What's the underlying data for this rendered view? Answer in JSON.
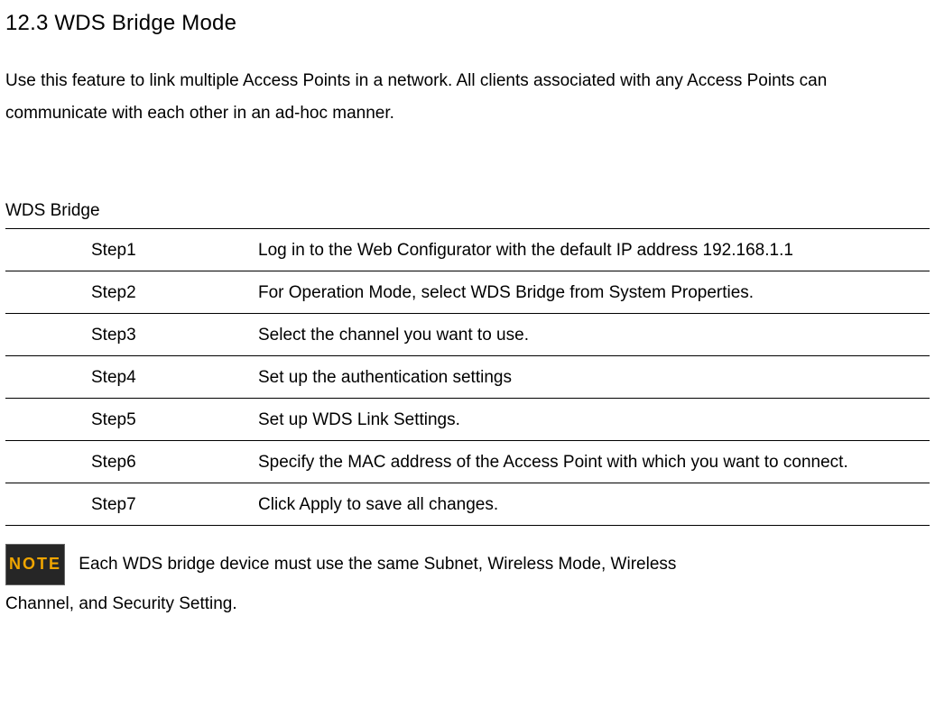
{
  "heading": "12.3 WDS Bridge Mode",
  "intro": "Use this feature to link multiple Access Points in a network. All clients associated with any Access Points can communicate with each other in an ad-hoc manner.",
  "table": {
    "title": "WDS Bridge",
    "steps": [
      {
        "label": "Step1",
        "desc": "Log in to the Web Configurator with the default IP address 192.168.1.1"
      },
      {
        "label": "Step2",
        "desc": "For Operation Mode, select WDS Bridge from System Properties."
      },
      {
        "label": "Step3",
        "desc": "Select the channel you want to use."
      },
      {
        "label": "Step4",
        "desc": "Set up the authentication settings"
      },
      {
        "label": "Step5",
        "desc": "Set up WDS Link Settings."
      },
      {
        "label": "Step6",
        "desc": "Specify the MAC address of the Access Point with which you want to connect."
      },
      {
        "label": "Step7",
        "desc": "Click Apply to save all changes."
      }
    ]
  },
  "note": {
    "badge": "NOTE",
    "text_part1": " Each WDS bridge device must use the same Subnet, Wireless Mode, Wireless ",
    "text_part2": "Channel, and Security Setting."
  }
}
